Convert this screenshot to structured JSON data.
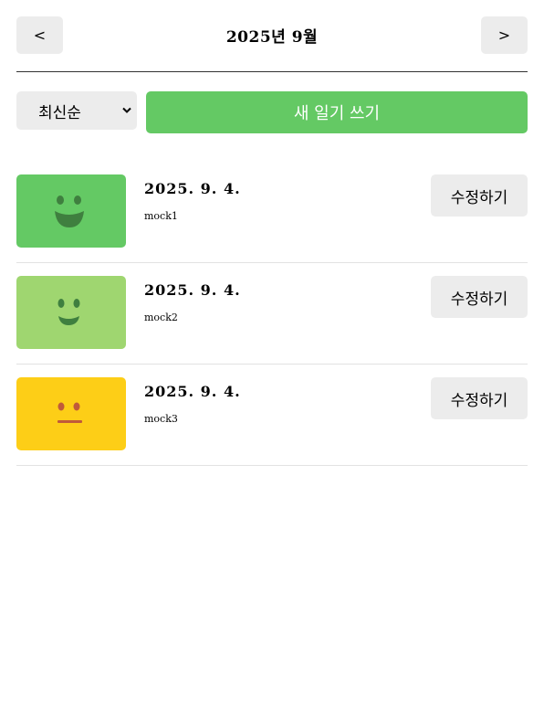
{
  "header": {
    "prev_label": "<",
    "next_label": ">",
    "title": "2025년 9월"
  },
  "toolbar": {
    "sort_selected": "최신순",
    "new_button_label": "새 일기 쓰기"
  },
  "colors": {
    "primary_green": "#64c964",
    "button_gray": "#ececec"
  },
  "diaries": [
    {
      "date": "2025. 9. 4.",
      "content": "mock1",
      "edit_label": "수정하기",
      "emotion_icon": "big-smile-face-icon",
      "emotion_color": "#64c964"
    },
    {
      "date": "2025. 9. 4.",
      "content": "mock2",
      "edit_label": "수정하기",
      "emotion_icon": "smile-face-icon",
      "emotion_color": "#9fd670"
    },
    {
      "date": "2025. 9. 4.",
      "content": "mock3",
      "edit_label": "수정하기",
      "emotion_icon": "neutral-face-icon",
      "emotion_color": "#fdce17"
    }
  ]
}
